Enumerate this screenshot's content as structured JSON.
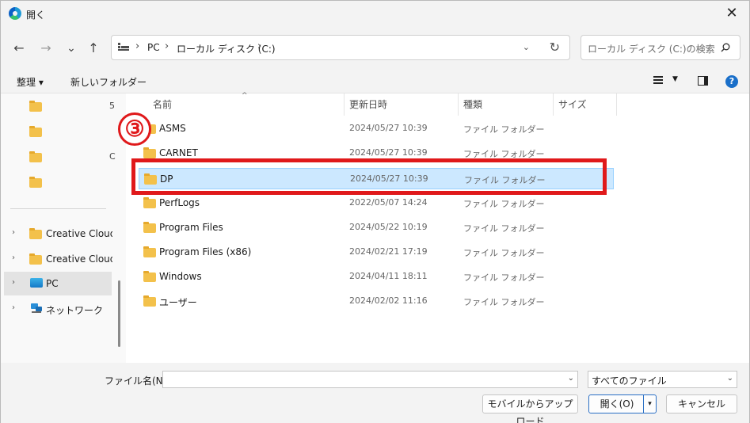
{
  "window": {
    "title": "開く",
    "close_glyph": "✕"
  },
  "nav": {
    "back": "←",
    "forward": "→",
    "recent": "⌄",
    "up": "↑"
  },
  "address": {
    "segments": [
      "PC",
      "ローカル ディスク (C:)"
    ],
    "separator": "›",
    "dropdown": "⌄",
    "refresh": "↻"
  },
  "search": {
    "placeholder": "ローカル ディスク (C:)の検索"
  },
  "commandbar": {
    "organize": "整理 ▾",
    "new_folder": "新しいフォルダー",
    "view_dropdown": "▼",
    "help": "?"
  },
  "sidebar": {
    "truncated_top": [
      "5",
      "",
      "C",
      ""
    ],
    "items": [
      {
        "label": "Creative Cloud F",
        "icon": "folder-icon",
        "chevron": "›",
        "selected": false
      },
      {
        "label": "Creative Cloud F",
        "icon": "folder-icon",
        "chevron": "›",
        "selected": false
      },
      {
        "label": "PC",
        "icon": "monitor-icon",
        "chevron": "›",
        "selected": true
      },
      {
        "label": "ネットワーク",
        "icon": "network-icon",
        "chevron": "›",
        "selected": false
      }
    ]
  },
  "columns": {
    "name": "名前",
    "date": "更新日時",
    "type": "種類",
    "size": "サイズ",
    "sort_arrow": "^"
  },
  "files": [
    {
      "name": "ASMS",
      "date": "2024/05/27 10:39",
      "type": "ファイル フォルダー",
      "selected": false
    },
    {
      "name": "CARNET",
      "date": "2024/05/27 10:39",
      "type": "ファイル フォルダー",
      "selected": false
    },
    {
      "name": "DP",
      "date": "2024/05/27 10:39",
      "type": "ファイル フォルダー",
      "selected": true
    },
    {
      "name": "PerfLogs",
      "date": "2022/05/07 14:24",
      "type": "ファイル フォルダー",
      "selected": false
    },
    {
      "name": "Program Files",
      "date": "2024/05/22 10:19",
      "type": "ファイル フォルダー",
      "selected": false
    },
    {
      "name": "Program Files (x86)",
      "date": "2024/02/21 17:19",
      "type": "ファイル フォルダー",
      "selected": false
    },
    {
      "name": "Windows",
      "date": "2024/04/11 18:11",
      "type": "ファイル フォルダー",
      "selected": false
    },
    {
      "name": "ユーザー",
      "date": "2024/02/02 11:16",
      "type": "ファイル フォルダー",
      "selected": false
    }
  ],
  "annotation": {
    "step": "③",
    "color": "#e0191b"
  },
  "footer": {
    "filename_label": "ファイル名(N):",
    "filename_value": "",
    "filetype": "すべてのファイル",
    "upload_button": "モバイルからアップロード",
    "open_button": "開く(O)",
    "open_split": "▾",
    "cancel_button": "キャンセル"
  },
  "colors": {
    "selection_bg": "#cce8ff",
    "selection_border": "#99d1ff",
    "folder": "#f3c14b",
    "accent": "#2a6fc5"
  }
}
